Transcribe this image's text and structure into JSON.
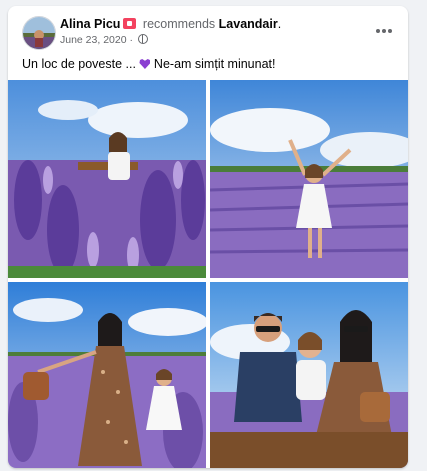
{
  "post": {
    "author": "Alina Picu",
    "action": "recommends",
    "page": "Lavandair",
    "page_suffix": ".",
    "date": "June 23, 2020",
    "date_sep": "·",
    "caption_text": "Un loc de poveste ...",
    "caption_end": "Ne-am simțit minunat!",
    "heart_emoji": "purple-heart",
    "accent_heart": "#8a3fd1",
    "badge_color": "#f3425f"
  },
  "photos": [
    {
      "label": "girl-in-lavender-field-1"
    },
    {
      "label": "girl-arms-raised-lavender"
    },
    {
      "label": "mother-daughter-lavender"
    },
    {
      "label": "family-on-bench-lavender"
    }
  ]
}
